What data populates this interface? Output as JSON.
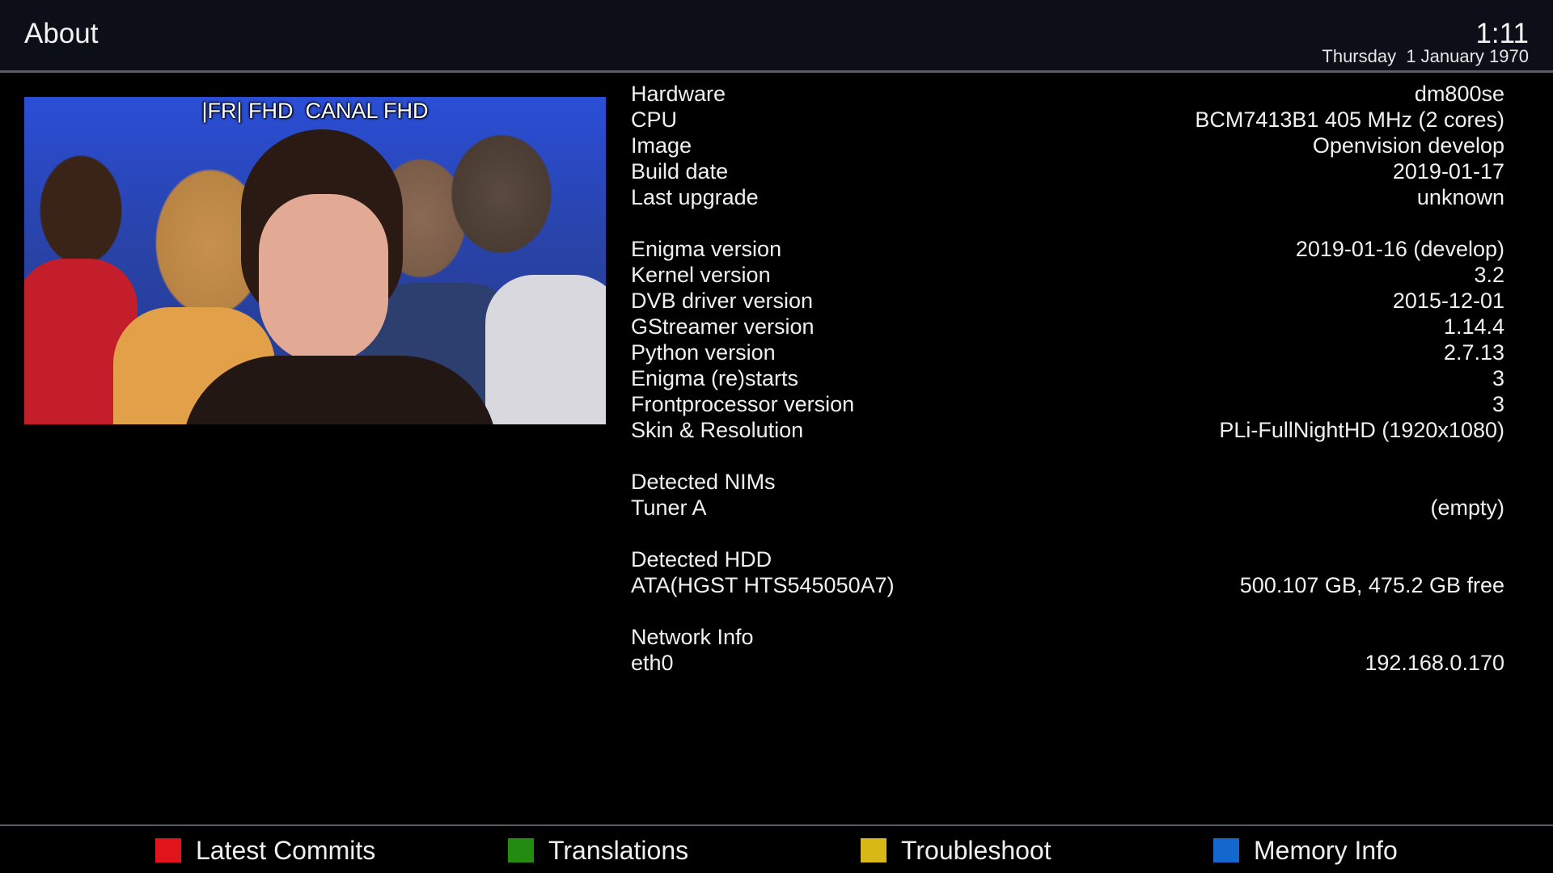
{
  "header": {
    "title": "About",
    "time": "1:11",
    "date": "Thursday  1 January 1970"
  },
  "preview": {
    "channel": "|FR| FHD  CANAL FHD"
  },
  "info": {
    "system": [
      {
        "label": "Hardware",
        "value": "dm800se"
      },
      {
        "label": "CPU",
        "value": "BCM7413B1 405 MHz (2 cores)"
      },
      {
        "label": "Image",
        "value": "Openvision develop"
      },
      {
        "label": "Build date",
        "value": "2019-01-17"
      },
      {
        "label": "Last upgrade",
        "value": "unknown"
      }
    ],
    "versions": [
      {
        "label": "Enigma version",
        "value": "2019-01-16 (develop)"
      },
      {
        "label": "Kernel version",
        "value": "3.2"
      },
      {
        "label": "DVB driver version",
        "value": "2015-12-01"
      },
      {
        "label": "GStreamer version",
        "value": "1.14.4"
      },
      {
        "label": "Python version",
        "value": "2.7.13"
      },
      {
        "label": "Enigma (re)starts",
        "value": "3"
      },
      {
        "label": "Frontprocessor version",
        "value": "3"
      },
      {
        "label": "Skin & Resolution",
        "value": "PLi-FullNightHD (1920x1080)"
      }
    ],
    "nims": {
      "title": "Detected NIMs",
      "items": [
        {
          "label": "Tuner A",
          "value": "(empty)"
        }
      ]
    },
    "hdd": {
      "title": "Detected HDD",
      "items": [
        {
          "label": "ATA(HGST HTS545050A7)",
          "value": "500.107 GB, 475.2 GB free"
        }
      ]
    },
    "network": {
      "title": "Network Info",
      "items": [
        {
          "label": "eth0",
          "value": "192.168.0.170"
        }
      ]
    }
  },
  "footer": {
    "red": {
      "label": "Latest Commits",
      "color": "#e0141a"
    },
    "green": {
      "label": "Translations",
      "color": "#228b10"
    },
    "yellow": {
      "label": "Troubleshoot",
      "color": "#d8b814"
    },
    "blue": {
      "label": "Memory Info",
      "color": "#1468cc"
    }
  }
}
